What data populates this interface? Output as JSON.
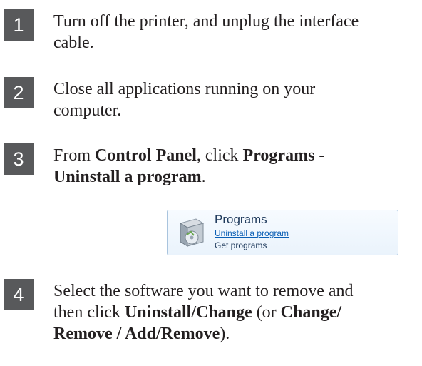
{
  "steps": [
    {
      "number": "1",
      "lines": [
        "Turn off the printer, and unplug the interface",
        "cable."
      ]
    },
    {
      "number": "2",
      "lines": [
        "Close all applications running on your",
        "computer."
      ]
    },
    {
      "number": "3",
      "line1_pre": "From ",
      "line1_b1": "Control Panel",
      "line1_mid": ", click ",
      "line1_b2": "Programs",
      "line1_post": " -",
      "line2_b": "Uninstall a program",
      "line2_post": "."
    },
    {
      "number": "4",
      "line1": "Select the software you want to remove and",
      "line2_pre": "then click ",
      "line2_b1": "Uninstall/Change",
      "line2_mid": " (or ",
      "line2_b2": "Change/",
      "line3_b": "Remove / Add/Remove",
      "line3_post": ")."
    }
  ],
  "screenshot": {
    "title": "Programs",
    "link": "Uninstall a program",
    "sub": "Get programs",
    "icon": "programs-box-icon"
  }
}
